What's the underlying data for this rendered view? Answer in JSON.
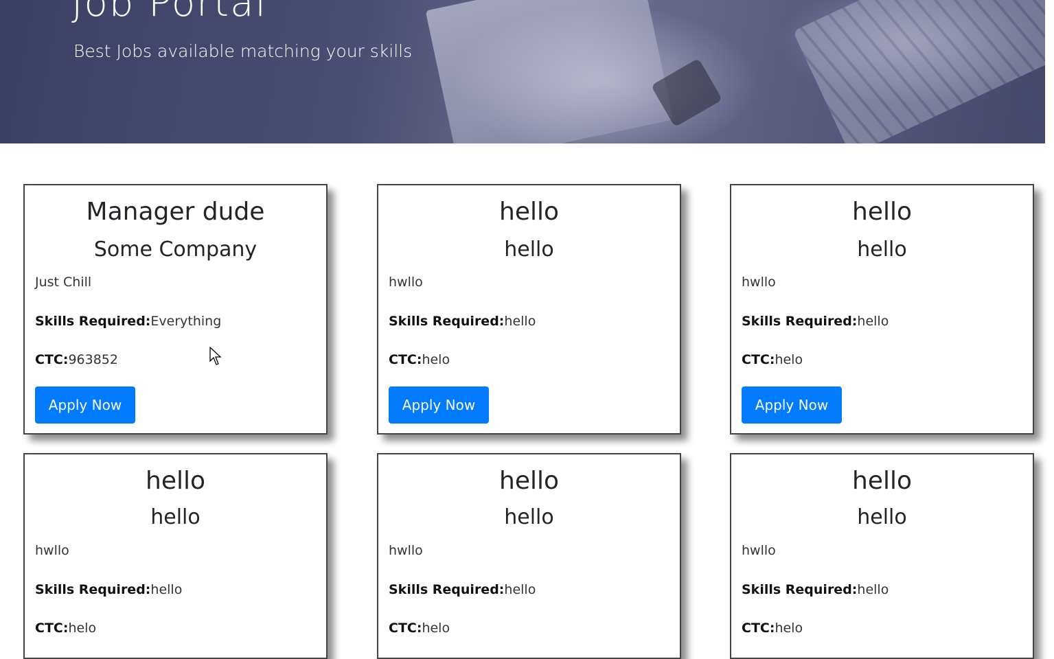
{
  "hero": {
    "title": "Job Portal",
    "subtitle": "Best Jobs available matching your skills"
  },
  "labels": {
    "skills": "Skills Required:",
    "ctc": "CTC:",
    "apply": "Apply Now"
  },
  "colors": {
    "primary_button": "#007bff"
  },
  "jobs": [
    {
      "title": "Manager dude",
      "company": "Some Company",
      "description": "Just Chill",
      "skills": "Everything",
      "ctc": "963852"
    },
    {
      "title": "hello",
      "company": "hello",
      "description": "hwllo",
      "skills": "hello",
      "ctc": "helo"
    },
    {
      "title": "hello",
      "company": "hello",
      "description": "hwllo",
      "skills": "hello",
      "ctc": "helo"
    },
    {
      "title": "hello",
      "company": "hello",
      "description": "hwllo",
      "skills": "hello",
      "ctc": "helo"
    },
    {
      "title": "hello",
      "company": "hello",
      "description": "hwllo",
      "skills": "hello",
      "ctc": "helo"
    },
    {
      "title": "hello",
      "company": "hello",
      "description": "hwllo",
      "skills": "hello",
      "ctc": "helo"
    }
  ]
}
